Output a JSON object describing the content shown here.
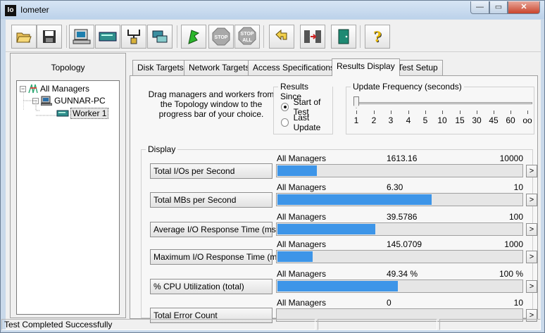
{
  "window": {
    "title": "Iometer",
    "icon_text": "Io",
    "min_symbol": "—",
    "max_symbol": "▭",
    "close_symbol": "✕"
  },
  "toolbar": {
    "buttons": [
      {
        "icon": "open-folder-icon"
      },
      {
        "icon": "save-disk-icon"
      },
      {
        "icon": "new-disk-worker-icon"
      },
      {
        "icon": "new-network-worker-icon"
      },
      {
        "icon": "duplicate-worker-icon"
      },
      {
        "icon": "disconnect-icon"
      },
      {
        "icon": "start-flag-icon"
      },
      {
        "icon": "stop-icon"
      },
      {
        "icon": "stop-all-icon"
      },
      {
        "icon": "reset-workers-icon"
      },
      {
        "icon": "exit-icon"
      },
      {
        "icon": "help-icon"
      }
    ],
    "stop_text": "STOP",
    "stop_all_text_1": "STOP",
    "stop_all_text_2": "ALL",
    "help_text": "?"
  },
  "topology": {
    "caption": "Topology",
    "root": "All Managers",
    "manager": "GUNNAR-PC",
    "worker": "Worker 1"
  },
  "tabs": [
    {
      "label": "Disk Targets",
      "active": false
    },
    {
      "label": "Network Targets",
      "active": false
    },
    {
      "label": "Access Specifications",
      "active": false
    },
    {
      "label": "Results Display",
      "active": true
    },
    {
      "label": "Test Setup",
      "active": false
    }
  ],
  "results": {
    "drag_text": "Drag managers and workers from the Topology window to the progress bar of your choice.",
    "results_since": {
      "label": "Results Since",
      "options": [
        {
          "label": "Start of Test",
          "selected": true
        },
        {
          "label": "Last Update",
          "selected": false
        }
      ]
    },
    "update_frequency": {
      "label": "Update Frequency (seconds)",
      "ticks": [
        "1",
        "2",
        "3",
        "4",
        "5",
        "10",
        "15",
        "30",
        "45",
        "60",
        "oo"
      ],
      "selected": "1"
    },
    "display_label": "Display",
    "metrics": [
      {
        "name": "Total I/Os per Second",
        "target": "All Managers",
        "value": "1613.16",
        "max": "10000",
        "fill": 0.16
      },
      {
        "name": "Total MBs per Second",
        "target": "All Managers",
        "value": "6.30",
        "max": "10",
        "fill": 0.63
      },
      {
        "name": "Average I/O Response Time (ms)",
        "target": "All Managers",
        "value": "39.5786",
        "max": "100",
        "fill": 0.4
      },
      {
        "name": "Maximum I/O Response Time (ms)",
        "target": "All Managers",
        "value": "145.0709",
        "max": "1000",
        "fill": 0.145
      },
      {
        "name": "% CPU Utilization (total)",
        "target": "All Managers",
        "value": "49.34 %",
        "max": "100 %",
        "fill": 0.4934
      },
      {
        "name": "Total Error Count",
        "target": "All Managers",
        "value": "0",
        "max": "10",
        "fill": 0
      }
    ],
    "arrow_symbol": ">"
  },
  "status": {
    "message": "Test Completed Successfully"
  }
}
